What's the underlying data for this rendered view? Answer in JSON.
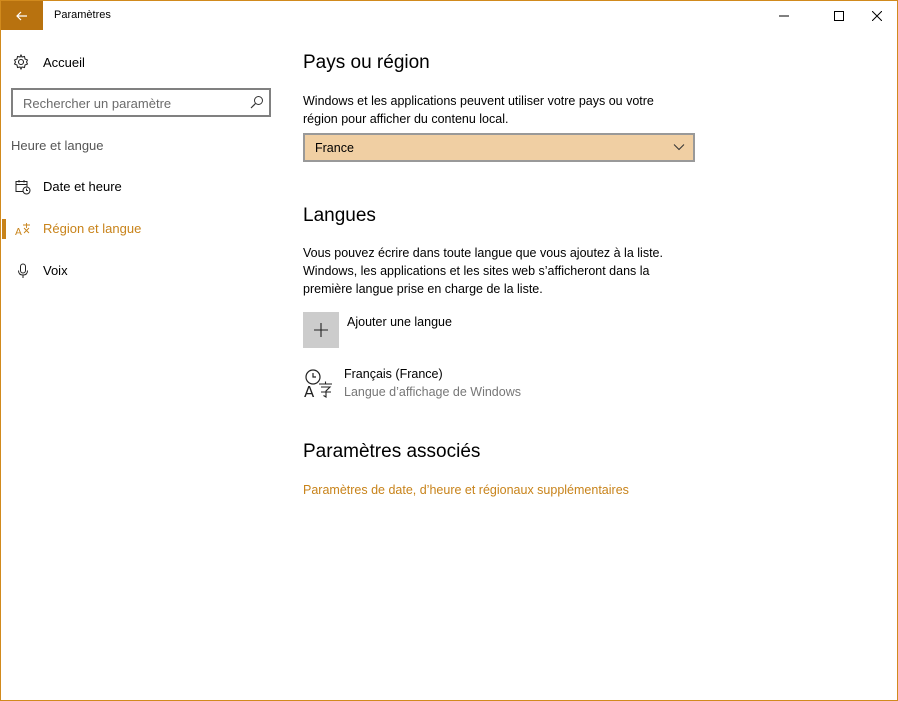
{
  "window": {
    "title": "Paramètres",
    "accent": "#c8831a"
  },
  "sidebar": {
    "home_label": "Accueil",
    "search": {
      "placeholder": "Rechercher un paramètre"
    },
    "section_title": "Heure et langue",
    "items": [
      {
        "label": "Date et heure",
        "icon": "calendar-clock-icon",
        "active": false
      },
      {
        "label": "Région et langue",
        "icon": "region-language-icon",
        "active": true
      },
      {
        "label": "Voix",
        "icon": "microphone-icon",
        "active": false
      }
    ]
  },
  "main": {
    "region": {
      "heading": "Pays ou région",
      "description_line1": "Windows et les applications peuvent utiliser votre pays ou votre",
      "description_line2": "région pour afficher du contenu local.",
      "selected": "France",
      "dropdown_color": "#f0cfa3"
    },
    "languages": {
      "heading": "Langues",
      "description_line1": "Vous pouvez écrire dans toute langue que vous ajoutez à la liste.",
      "description_line2": "Windows, les applications et les sites web s’afficheront dans la",
      "description_line3": "première langue prise en charge de la liste.",
      "add_label": "Ajouter une langue",
      "items": [
        {
          "name": "Français (France)",
          "subtitle": "Langue d’affichage de Windows"
        }
      ]
    },
    "related": {
      "heading": "Paramètres associés",
      "link": "Paramètres de date, d’heure et régionaux supplémentaires"
    }
  }
}
